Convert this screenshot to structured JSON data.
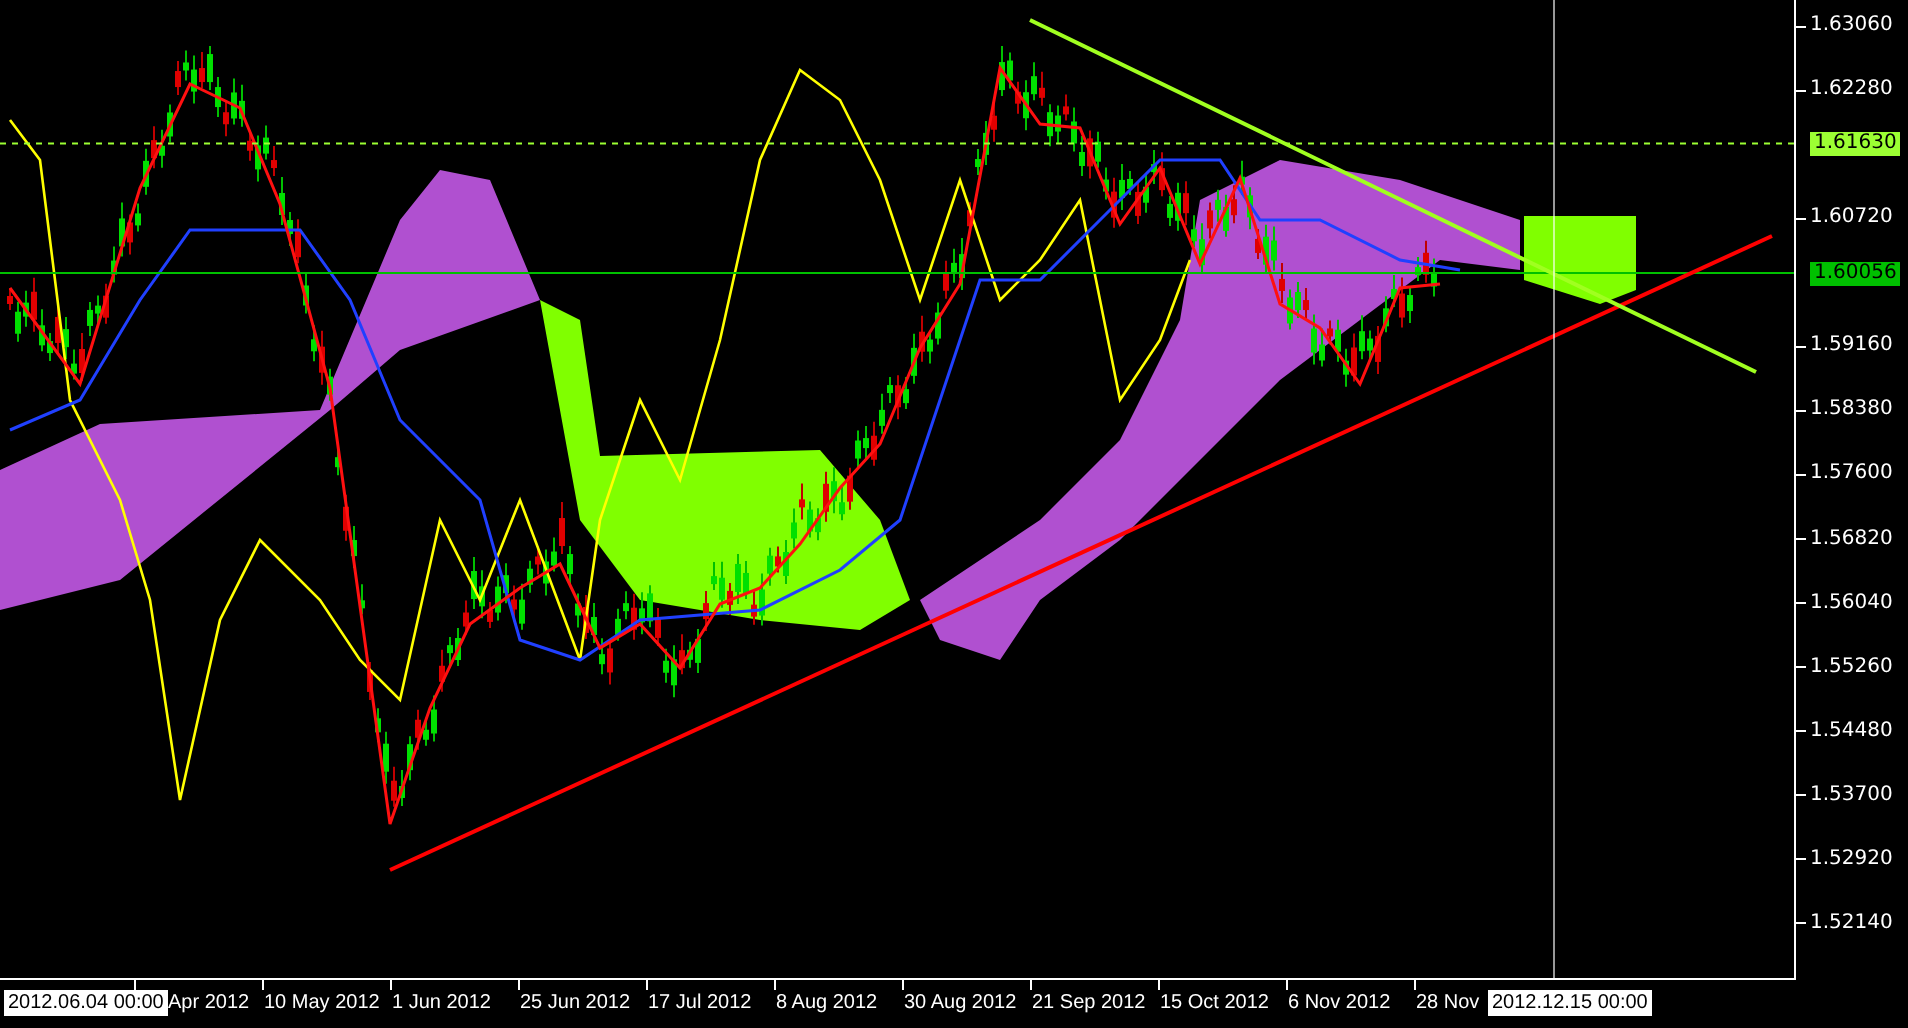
{
  "price_axis": {
    "ticks": [
      "1.63060",
      "1.62280",
      "1.60720",
      "1.59160",
      "1.58380",
      "1.57600",
      "1.56820",
      "1.56040",
      "1.55260",
      "1.54480",
      "1.53700",
      "1.52920",
      "1.52140"
    ],
    "levels": [
      {
        "label": "1.61630",
        "kind": "dashed",
        "color": "#9cff33"
      },
      {
        "label": "1.60056",
        "kind": "solid",
        "color": "#00c000"
      }
    ]
  },
  "time_axis": {
    "labels": [
      "Apr 2012",
      "10 May 2012",
      "1 Jun 2012",
      "25 Jun 2012",
      "17 Jul 2012",
      "8 Aug 2012",
      "30 Aug 2012",
      "21 Sep 2012",
      "15 Oct 2012",
      "6 Nov 2012",
      "28 Nov"
    ],
    "cursor_start": "2012.06.04 00:00",
    "cursor_end": "2012.12.15 00:00"
  }
}
